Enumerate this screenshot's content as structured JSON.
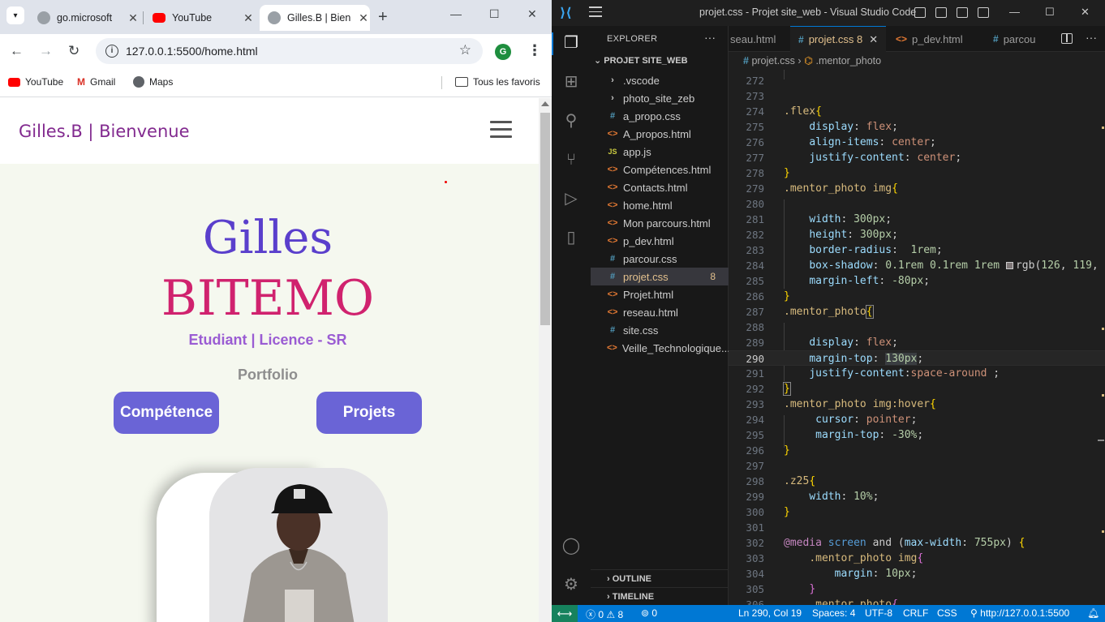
{
  "browser": {
    "tabs": [
      {
        "title": "go.microsoft",
        "close": "✕"
      },
      {
        "title": "YouTube",
        "close": "✕"
      },
      {
        "title": "Gilles.B | Bien",
        "close": "✕"
      }
    ],
    "url": "127.0.0.1:5500/home.html",
    "profile_initial": "G",
    "bookmarks": [
      "YouTube",
      "Gmail",
      "Maps"
    ],
    "all_bookmarks": "Tous les favoris"
  },
  "site": {
    "brand": "Gilles.B | Bienvenue",
    "first_name": "Gilles",
    "last_name": "BITEMO",
    "subtitle": "Etudiant | Licence - SR",
    "portfolio": "Portfolio",
    "btn_competence": "Compétence",
    "btn_projets": "Projets"
  },
  "vscode": {
    "title": "projet.css - Projet site_web - Visual Studio Code",
    "explorer_label": "EXPLORER",
    "project": "PROJET SITE_WEB",
    "files": [
      {
        "name": ".vscode",
        "type": "folder"
      },
      {
        "name": "photo_site_zeb",
        "type": "folder"
      },
      {
        "name": "a_propo.css",
        "type": "css"
      },
      {
        "name": "A_propos.html",
        "type": "html"
      },
      {
        "name": "app.js",
        "type": "js"
      },
      {
        "name": "Compétences.html",
        "type": "html"
      },
      {
        "name": "Contacts.html",
        "type": "html"
      },
      {
        "name": "home.html",
        "type": "html"
      },
      {
        "name": "Mon parcours.html",
        "type": "html"
      },
      {
        "name": "p_dev.html",
        "type": "html"
      },
      {
        "name": "parcour.css",
        "type": "css"
      },
      {
        "name": "projet.css",
        "type": "css",
        "badge": "8",
        "selected": true
      },
      {
        "name": "Projet.html",
        "type": "html"
      },
      {
        "name": "reseau.html",
        "type": "html"
      },
      {
        "name": "site.css",
        "type": "css"
      },
      {
        "name": "Veille_Technologique....",
        "type": "html"
      }
    ],
    "outline": "OUTLINE",
    "timeline": "TIMELINE",
    "editor_tabs": [
      {
        "name": "seau.html"
      },
      {
        "name": "projet.css",
        "badge": "8",
        "active": true
      },
      {
        "name": "p_dev.html"
      },
      {
        "name": "parcou"
      }
    ],
    "breadcrumb_file": "projet.css",
    "breadcrumb_symbol": ".mentor_photo",
    "line_numbers": [
      "272",
      "273",
      "274",
      "275",
      "276",
      "277",
      "278",
      "279",
      "280",
      "281",
      "282",
      "283",
      "284",
      "285",
      "286",
      "287",
      "288",
      "289",
      "290",
      "291",
      "292",
      "293",
      "294",
      "295",
      "296",
      "297",
      "298",
      "299",
      "300",
      "301",
      "302",
      "303",
      "304",
      "305",
      "306"
    ],
    "status": {
      "errors": "0",
      "warnings": "8",
      "ports": "0",
      "position": "Ln 290, Col 19",
      "spaces": "Spaces: 4",
      "encoding": "UTF-8",
      "eol": "CRLF",
      "language": "CSS",
      "live": "http://127.0.0.1:5500"
    }
  }
}
